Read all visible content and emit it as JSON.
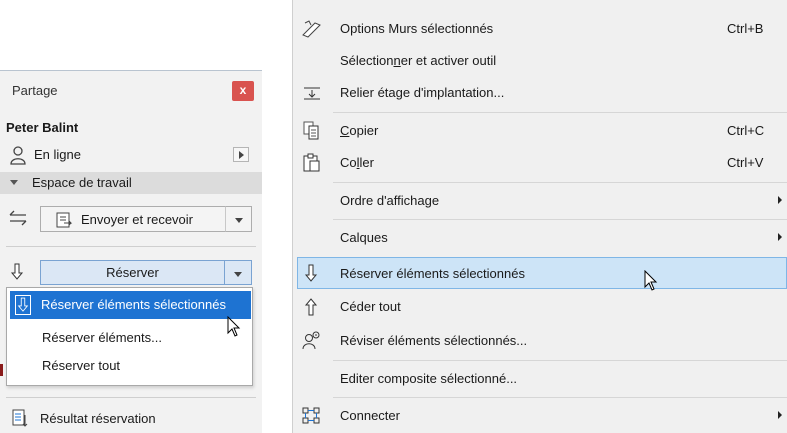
{
  "panel": {
    "title": "Partage",
    "close_label": "x",
    "user_name": "Peter Balint",
    "status": "En ligne",
    "section": "Espace de travail",
    "send_receive": "Envoyer et recevoir",
    "reserve": "Réserver",
    "dropdown": [
      {
        "label": "Réserver éléments sélectionnés",
        "highlighted": true
      },
      {
        "label": "Réserver éléments...",
        "highlighted": false
      },
      {
        "label": "Réserver tout",
        "highlighted": false
      }
    ],
    "result": "Résultat réservation"
  },
  "menu": {
    "items": [
      {
        "id": "options",
        "pre": "Options Murs sélectionnés",
        "u": "",
        "post": "",
        "shortcut": "Ctrl+B",
        "icon": "wall-options-icon"
      },
      {
        "id": "select",
        "pre": "Sélection",
        "u": "n",
        "post": "er et activer outil",
        "shortcut": "",
        "icon": ""
      },
      {
        "id": "link",
        "pre": "Relier étage d'implantation...",
        "u": "",
        "post": "",
        "shortcut": "",
        "icon": "story-link-icon"
      },
      {
        "id": "copy",
        "pre": "",
        "u": "C",
        "post": "opier",
        "shortcut": "Ctrl+C",
        "icon": "copy-icon"
      },
      {
        "id": "paste",
        "pre": "Co",
        "u": "l",
        "post": "ler",
        "shortcut": "Ctrl+V",
        "icon": "paste-icon"
      },
      {
        "id": "order",
        "pre": "Ordre d'affichage",
        "u": "",
        "post": "",
        "shortcut": "",
        "icon": "",
        "submenu": true
      },
      {
        "id": "layers",
        "pre": "Calques",
        "u": "",
        "post": "",
        "shortcut": "",
        "icon": "",
        "submenu": true
      },
      {
        "id": "reserve",
        "pre": "Réserver éléments sélectionnés",
        "u": "",
        "post": "",
        "shortcut": "",
        "icon": "reserve-icon",
        "highlighted": true
      },
      {
        "id": "release",
        "pre": "Céder tout",
        "u": "",
        "post": "",
        "shortcut": "",
        "icon": "release-icon"
      },
      {
        "id": "review",
        "pre": "Réviser éléments sélectionnés...",
        "u": "",
        "post": "",
        "shortcut": "",
        "icon": "review-icon"
      },
      {
        "id": "composite",
        "pre": "Editer composite sélectionné...",
        "u": "",
        "post": "",
        "shortcut": "",
        "icon": ""
      },
      {
        "id": "connect",
        "pre": "Connecter",
        "u": "",
        "post": "",
        "shortcut": "",
        "icon": "connect-icon",
        "submenu": true
      }
    ]
  },
  "colors": {
    "highlight": "#1e73d2",
    "menu_highlight": "#cde4f7",
    "close_red": "#d9534f"
  }
}
